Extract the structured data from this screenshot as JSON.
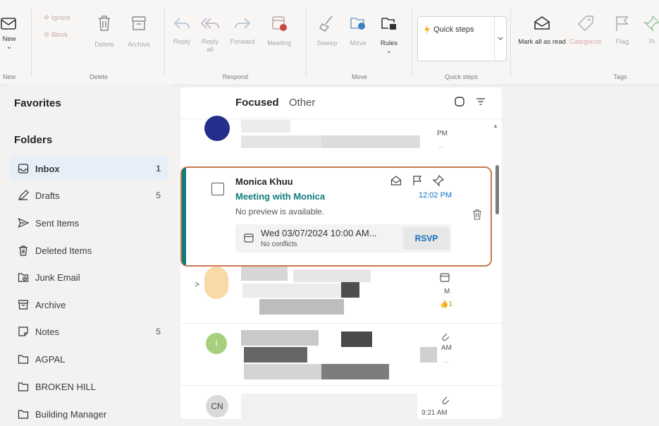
{
  "ribbon": {
    "new": {
      "label": "New",
      "chevron": "⌄",
      "group": "New"
    },
    "delete_group": {
      "ignore": "Ignore",
      "block": "Block",
      "delete": "Delete",
      "archive": "Archive",
      "label": "Delete"
    },
    "respond_group": {
      "reply": "Reply",
      "reply_all": "Reply all",
      "forward": "Forward",
      "meeting": "Meeting",
      "label": "Respond"
    },
    "move_group": {
      "sweep": "Sweep",
      "move": "Move",
      "rules": "Rules",
      "rules_chevron": "⌄",
      "label": "Move"
    },
    "quick_steps": {
      "label": "Quick steps",
      "group": "Quick steps"
    },
    "tags_group": {
      "mark_all_read": "Mark all as read",
      "categorize": "Categorize",
      "flag": "Flag",
      "pin": "Pi",
      "label": "Tags"
    }
  },
  "folders": {
    "favorites": "Favorites",
    "folders": "Folders",
    "items": [
      {
        "label": "Inbox",
        "count": "1",
        "icon": "inbox-icon"
      },
      {
        "label": "Drafts",
        "count": "5",
        "icon": "drafts-icon"
      },
      {
        "label": "Sent Items",
        "count": "",
        "icon": "sent-icon"
      },
      {
        "label": "Deleted Items",
        "count": "",
        "icon": "trash-icon"
      },
      {
        "label": "Junk Email",
        "count": "",
        "icon": "junk-icon"
      },
      {
        "label": "Archive",
        "count": "",
        "icon": "archive-icon"
      },
      {
        "label": "Notes",
        "count": "5",
        "icon": "notes-icon"
      },
      {
        "label": "AGPAL",
        "count": "",
        "icon": "folder-icon"
      },
      {
        "label": "BROKEN HILL",
        "count": "",
        "icon": "folder-icon"
      },
      {
        "label": "Building Manager",
        "count": "",
        "icon": "folder-icon"
      }
    ]
  },
  "list": {
    "tab_focused": "Focused",
    "tab_other": "Other",
    "row1": {
      "time": "PM",
      "more": "..."
    },
    "selected": {
      "sender": "Monica Khuu",
      "subject": "Meeting with Monica",
      "preview": "No preview is available.",
      "time": "12:02 PM",
      "meeting_date": "Wed 03/07/2024 10:00 AM...",
      "meeting_conflicts": "No conflicts",
      "rsvp": "RSVP"
    },
    "row3": {
      "chev": ">",
      "time": "M",
      "count": "1"
    },
    "row4": {
      "avatar": "I",
      "time": "AM",
      "more": "..."
    },
    "row5": {
      "avatar": "CN",
      "time": "9:21 AM"
    }
  },
  "colors": {
    "accent": "#0f7b7b",
    "link": "#0f6cbd",
    "highlight": "#c9794f"
  }
}
